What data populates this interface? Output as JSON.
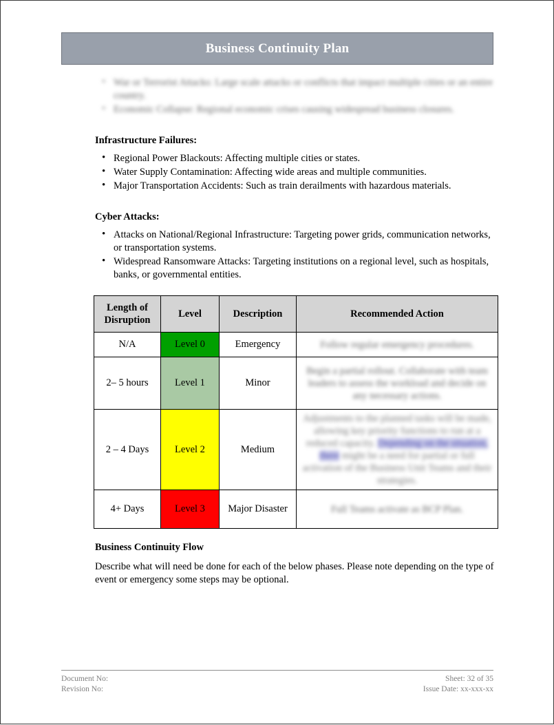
{
  "document": {
    "banner_title": "Business Continuity Plan"
  },
  "top_bullets": {
    "items": [
      "War or Terrorist Attacks: Large scale attacks or conflicts that impact multiple cities or an entire country.",
      "Economic Collapse: Regional economic crises causing widespread business closures."
    ]
  },
  "infrastructure": {
    "heading": "Infrastructure Failures:",
    "items": [
      "Regional Power Blackouts: Affecting multiple cities or states.",
      "Water Supply Contamination: Affecting wide areas and multiple communities.",
      "Major Transportation Accidents: Such as train derailments with hazardous materials."
    ]
  },
  "cyber": {
    "heading": "Cyber Attacks:",
    "items": [
      "Attacks on National/Regional Infrastructure: Targeting power grids, communication networks, or transportation systems.",
      "Widespread Ransomware Attacks: Targeting institutions on a regional level, such as hospitals, banks, or governmental entities."
    ]
  },
  "matrix": {
    "headers": {
      "length": "Length of Disruption",
      "level": "Level",
      "description": "Description",
      "action": "Recommended Action"
    },
    "rows": [
      {
        "length": "N/A",
        "level": "Level 0",
        "description": "Emergency",
        "action": "Follow regular emergency procedures.",
        "level_color": "#00A000"
      },
      {
        "length": "2– 5 hours",
        "level": "Level 1",
        "description": "Minor",
        "action": "Begin a partial rollout. Collaborate with team leaders to assess the workload and decide on any necessary actions.",
        "level_color": "#A9C9A4"
      },
      {
        "length": "2 – 4 Days",
        "level": "Level 2",
        "description": "Medium",
        "action_part_1": "Adjustments to the planned tasks will be made, allowing key priority functions to run at a reduced capacity. ",
        "action_link": "Depending on the situation, there",
        "action_part_2": " might be a need for partial or full activation of the Business Unit Teams and their strategies.",
        "level_color": "#FFFF00"
      },
      {
        "length": "4+ Days",
        "level": "Level 3",
        "description": "Major Disaster",
        "action": "Full Teams activate as BCP Plan.",
        "level_color": "#FF0000"
      }
    ]
  },
  "flow": {
    "heading": "Business Continuity Flow",
    "paragraph": "Describe what will need be done for each of the below phases. Please note depending on the type of event or emergency some steps may be optional."
  },
  "footer": {
    "document_no": "Document No:",
    "revision_no": "Revision No:",
    "sheet": "Sheet: 32 of 35",
    "issue_date": "Issue Date: xx-xxx-xx"
  },
  "colors": {
    "banner": "#99A0AB",
    "table_header": "#D4D4D4",
    "link_highlight": "#C7C8E8"
  }
}
